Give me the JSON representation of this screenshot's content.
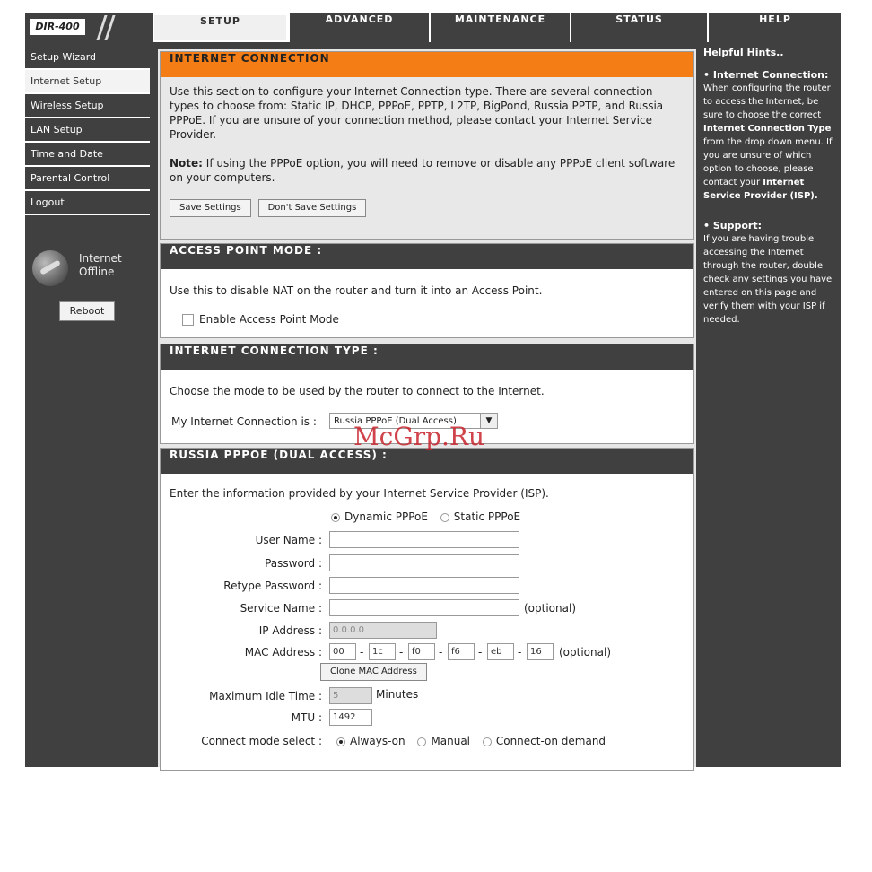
{
  "logo": {
    "text": "DIR-400"
  },
  "tabs": [
    {
      "label": "SETUP",
      "active": true
    },
    {
      "label": "ADVANCED"
    },
    {
      "label": "MAINTENANCE"
    },
    {
      "label": "STATUS"
    },
    {
      "label": "HELP"
    }
  ],
  "sidebar": {
    "items": [
      {
        "label": "Setup Wizard"
      },
      {
        "label": "Internet Setup",
        "active": true
      },
      {
        "label": "Wireless Setup"
      },
      {
        "label": "LAN Setup"
      },
      {
        "label": "Time and Date"
      },
      {
        "label": "Parental Control"
      },
      {
        "label": "Logout"
      }
    ],
    "status_line1": "Internet",
    "status_line2": "Offline",
    "reboot_label": "Reboot"
  },
  "internet_connection": {
    "title": "INTERNET CONNECTION",
    "description": "Use this section to configure your Internet Connection type. There are several connection types to choose from: Static IP, DHCP, PPPoE, PPTP, L2TP, BigPond, Russia PPTP, and Russia PPPoE. If you are unsure of your connection method, please contact your Internet Service Provider.",
    "note_label": "Note:",
    "note_text": " If using the PPPoE option, you will need to remove or disable any PPPoE client software on your computers.",
    "save_label": "Save Settings",
    "dont_save_label": "Don't Save Settings"
  },
  "access_point": {
    "title": "ACCESS POINT MODE :",
    "description": "Use this to disable NAT on the router and turn it into an Access Point.",
    "checkbox_label": "Enable Access Point Mode"
  },
  "connection_type": {
    "title": "INTERNET CONNECTION TYPE :",
    "description": "Choose the mode to be used by the router to connect to the Internet.",
    "select_label": "My Internet Connection is :",
    "selected": "Russia PPPoE (Dual Access)"
  },
  "pppoe": {
    "title": "RUSSIA PPPOE (DUAL ACCESS) :",
    "description": "Enter the information provided by your Internet Service Provider (ISP).",
    "dynamic_label": "Dynamic PPPoE",
    "static_label": "Static PPPoE",
    "user_name_label": "User Name :",
    "password_label": "Password :",
    "retype_label": "Retype Password :",
    "service_label": "Service Name :",
    "optional": "(optional)",
    "ip_label": "IP Address :",
    "ip_value": "0.0.0.0",
    "mac_label": "MAC Address :",
    "mac": [
      "00",
      "1c",
      "f0",
      "f6",
      "eb",
      "16"
    ],
    "mac_sep": "-",
    "clone_label": "Clone MAC Address",
    "idle_label": "Maximum Idle Time :",
    "idle_value": "5",
    "idle_unit": "Minutes",
    "mtu_label": "MTU :",
    "mtu_value": "1492",
    "connect_label": "Connect mode select :",
    "always_on": "Always-on",
    "manual": "Manual",
    "on_demand": "Connect-on demand"
  },
  "help": {
    "title": "Helpful Hints..",
    "ic_head": "• Internet Connection:",
    "ic_text1": "When configuring the router to access the Internet, be sure to choose the correct ",
    "ic_bold1": "Internet Connection Type",
    "ic_text2": " from the drop down menu. If you are unsure of which option to choose, please contact your ",
    "ic_bold2": "Internet Service Provider (ISP).",
    "support_head": "• Support:",
    "support_text": "If you are having trouble accessing the Internet through the router, double check any settings you have entered on this page and verify them with your ISP if needed."
  },
  "watermark": "McGrp.Ru"
}
